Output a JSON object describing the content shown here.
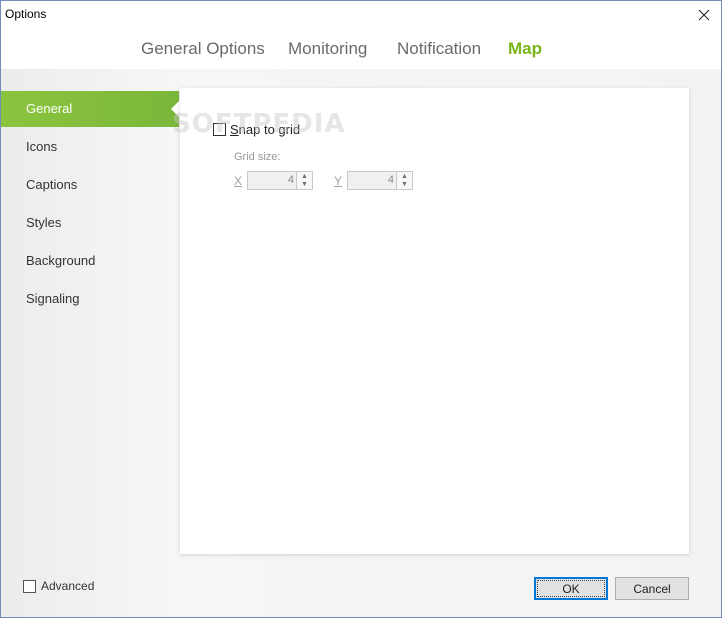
{
  "window": {
    "title": "Options"
  },
  "tabs": [
    {
      "label": "General Options",
      "active": false
    },
    {
      "label": "Monitoring",
      "active": false
    },
    {
      "label": "Notification",
      "active": false
    },
    {
      "label": "Map",
      "active": true
    }
  ],
  "sidebar": {
    "items": [
      {
        "label": "General",
        "active": true
      },
      {
        "label": "Icons",
        "active": false
      },
      {
        "label": "Captions",
        "active": false
      },
      {
        "label": "Styles",
        "active": false
      },
      {
        "label": "Background",
        "active": false
      },
      {
        "label": "Signaling",
        "active": false
      }
    ]
  },
  "panel": {
    "snap_to_grid": {
      "label_prefix": "S",
      "label_rest": "nap to grid",
      "checked": false
    },
    "grid_size_label": "Grid size:",
    "x": {
      "label": "X",
      "value": "4"
    },
    "y": {
      "label": "Y",
      "value": "4"
    }
  },
  "footer": {
    "advanced_label": "Advanced",
    "advanced_checked": false,
    "ok_label": "OK",
    "cancel_label": "Cancel"
  },
  "watermark": "SOFTPEDIA",
  "colors": {
    "accent": "#7cb41b",
    "sidebar_active": "#8bc53f"
  },
  "icons": {
    "close": "close-icon",
    "spin_up": "chevron-up-icon",
    "spin_down": "chevron-down-icon"
  }
}
